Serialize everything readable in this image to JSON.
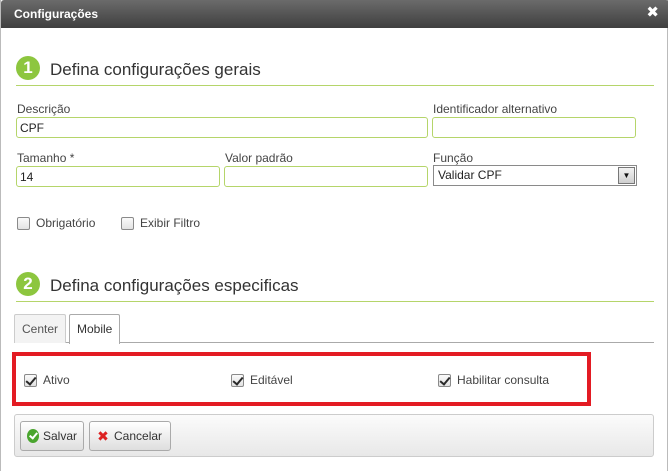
{
  "window": {
    "title": "Configurações",
    "close_glyph": "✖"
  },
  "section1": {
    "number": "1",
    "heading": "Defina configurações gerais",
    "fields": {
      "descricao": {
        "label": "Descrição",
        "value": "CPF"
      },
      "identificador": {
        "label": "Identificador alternativo",
        "value": ""
      },
      "tamanho": {
        "label": "Tamanho *",
        "value": "14"
      },
      "valor_padrao": {
        "label": "Valor padrão",
        "value": ""
      },
      "funcao": {
        "label": "Função",
        "selected": "Validar CPF"
      }
    },
    "checkboxes": {
      "obrigatorio": {
        "label": "Obrigatório",
        "checked": false
      },
      "exibir_filtro": {
        "label": "Exibir Filtro",
        "checked": false
      }
    }
  },
  "section2": {
    "number": "2",
    "heading": "Defina configurações especificas",
    "tabs": [
      {
        "label": "Center",
        "active": false
      },
      {
        "label": "Mobile",
        "active": true
      }
    ],
    "mobile_options": {
      "ativo": {
        "label": "Ativo",
        "checked": true
      },
      "editavel": {
        "label": "Editável",
        "checked": true
      },
      "habilitar_consulta": {
        "label": "Habilitar consulta",
        "checked": true
      }
    }
  },
  "footer": {
    "save_label": "Salvar",
    "cancel_label": "Cancelar",
    "cancel_glyph": "✖"
  },
  "colors": {
    "accent_green": "#8dc63f",
    "highlight_red": "#e31b23"
  },
  "icons": {
    "save": "check-circle-icon",
    "cancel": "x-icon",
    "select": "chevron-down-icon"
  }
}
